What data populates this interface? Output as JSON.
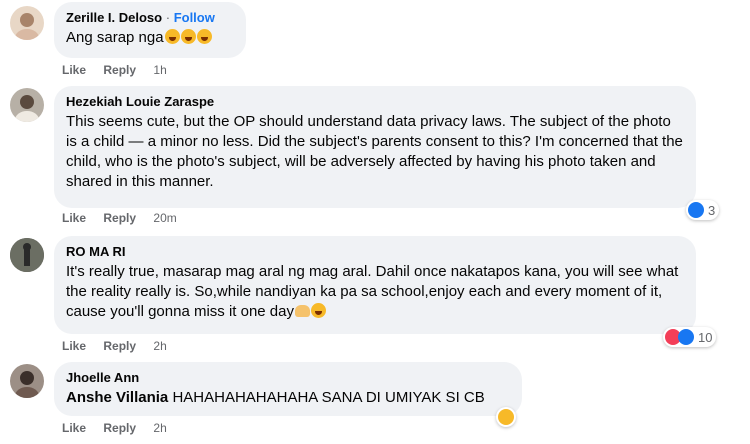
{
  "comments": [
    {
      "author": "Zerille I. Deloso",
      "separator": "·",
      "follow_label": "Follow",
      "text": "Ang sarap nga",
      "emoji": [
        "rolling-on-floor-laughing",
        "rolling-on-floor-laughing",
        "rolling-on-floor-laughing"
      ],
      "like_label": "Like",
      "reply_label": "Reply",
      "time": "1h"
    },
    {
      "author": "Hezekiah Louie Zaraspe",
      "text": "This seems cute, but the OP should understand data privacy laws. The subject of the photo is a child — a minor no less. Did the subject's parents consent to this? I'm concerned that the child, who is the photo's subject, will be adversely affected by having his photo taken and shared in this manner.",
      "like_label": "Like",
      "reply_label": "Reply",
      "time": "20m",
      "reactions": {
        "icons": [
          "like-icon"
        ],
        "count": "3"
      }
    },
    {
      "author": "RO MA RI",
      "text": "It's really true, masarap mag aral ng mag aral. Dahil once nakatapos kana, you will see what the reality really is. So,while nandiyan ka pa sa school,enjoy each and every moment of it, cause you'll gonna miss it one day",
      "emoji": [
        "heart-hands",
        "smiling-face"
      ],
      "like_label": "Like",
      "reply_label": "Reply",
      "time": "2h",
      "reactions": {
        "icons": [
          "love-icon",
          "like-icon"
        ],
        "count": "10"
      }
    },
    {
      "author": "Jhoelle Ann",
      "mention": "Anshe Villania",
      "text": "HAHAHAHAHAHAHA SANA DI UMIYAK SI CB",
      "like_label": "Like",
      "reply_label": "Reply",
      "time": "2h",
      "reactions": {
        "icons": [
          "haha-icon"
        ],
        "count": ""
      }
    }
  ],
  "colors": {
    "bubble": "#f0f2f5",
    "link": "#1877f2",
    "muted": "#65676b",
    "like": "#1877f2",
    "love": "#f33e58",
    "haha": "#f7b928"
  }
}
